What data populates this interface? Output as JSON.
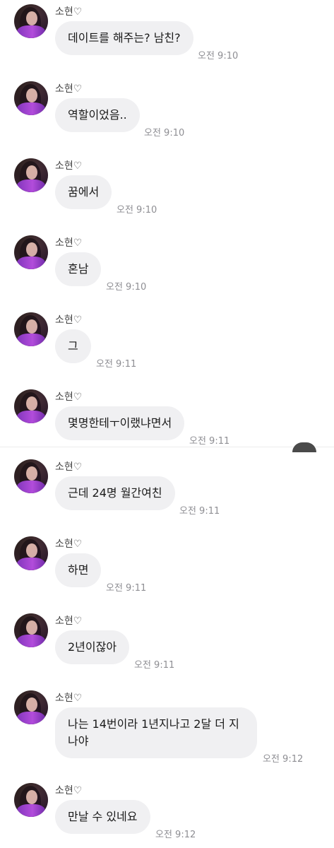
{
  "sender_name": "소현♡",
  "messages": [
    {
      "text": "데이트를 해주는? 남친?",
      "time": "오전 9:10"
    },
    {
      "text": "역할이었음..",
      "time": "오전 9:10"
    },
    {
      "text": "꿈에서",
      "time": "오전 9:10"
    },
    {
      "text": "혼남",
      "time": "오전 9:10"
    },
    {
      "text": "그",
      "time": "오전 9:11"
    },
    {
      "text": "몇명한테ㅜ이랬냐면서",
      "time": "오전 9:11"
    },
    {
      "text": "근데 24명 월간여친",
      "time": "오전 9:11"
    },
    {
      "text": "하면",
      "time": "오전 9:11"
    },
    {
      "text": "2년이잖아",
      "time": "오전 9:11"
    },
    {
      "text": "나는 14번이라 1년지나고 2달 더 지나야",
      "time": "오전 9:12"
    },
    {
      "text": "만날 수 있네요",
      "time": "오전 9:12"
    }
  ]
}
